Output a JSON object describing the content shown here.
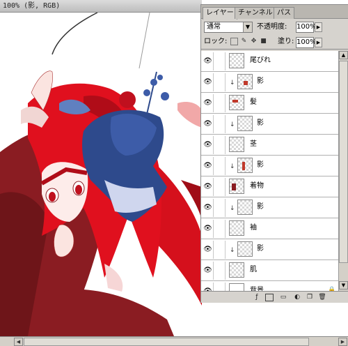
{
  "document": {
    "title": "100% (影, RGB)"
  },
  "palette": {
    "tabs": [
      "レイヤー",
      "チャンネル",
      "パス"
    ],
    "blend_mode": "通常",
    "opacity_label": "不透明度:",
    "opacity_value": "100%",
    "lock_label": "ロック:",
    "fill_label": "塗り:",
    "fill_value": "100%",
    "layers": [
      {
        "name": "尾びれ",
        "clipped": false
      },
      {
        "name": "影",
        "clipped": true
      },
      {
        "name": "髪",
        "clipped": false
      },
      {
        "name": "影",
        "clipped": true
      },
      {
        "name": "茎",
        "clipped": false
      },
      {
        "name": "影",
        "clipped": true
      },
      {
        "name": "着物",
        "clipped": false
      },
      {
        "name": "影",
        "clipped": true
      },
      {
        "name": "袖",
        "clipped": false
      },
      {
        "name": "影",
        "clipped": true
      },
      {
        "name": "肌",
        "clipped": false
      },
      {
        "name": "背景",
        "clipped": false,
        "locked": true
      }
    ]
  },
  "icons": {
    "eye": "eye-icon",
    "link": "link-icon",
    "lock": "lock-icon"
  },
  "colors": {
    "hair": "#e0101e",
    "kimono": "#8a1c22",
    "bow": "#2e4a8c"
  }
}
